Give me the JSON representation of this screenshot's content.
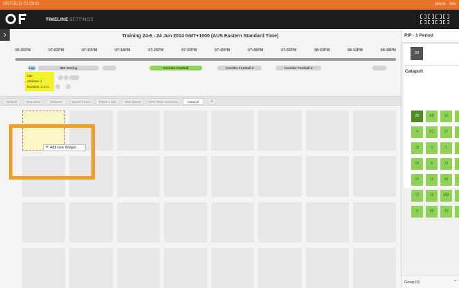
{
  "app": {
    "brand": "ORFIELD CLOUD",
    "user": "peeps · telu"
  },
  "nav": {
    "timeline": "TIMELINE",
    "settings": "SETTINGS"
  },
  "timeline": {
    "title": "Training 24-6 - 24 Jun 2014 GMT+1000 (AUS Eastern Standard Time)",
    "times": [
      "06:55PM",
      "07:02PM",
      "07:10PM",
      "07:18PM",
      "07:25PM",
      "07:33PM",
      "07:40PM",
      "07:48PM",
      "07:55PM",
      "08:03PM",
      "08:11PM",
      "08:18PM"
    ],
    "lanes": [
      {
        "label": "Lap",
        "style": "blue"
      },
      {
        "label": "IMA Testing",
        "style": "gray"
      },
      {
        "label": "",
        "style": "gray"
      },
      {
        "label": "Corridor Football",
        "style": "green"
      },
      {
        "label": "Corridor Football 2",
        "style": "gray"
      },
      {
        "label": "Corridor Football 3",
        "style": "gray"
      },
      {
        "label": "",
        "style": "gray"
      }
    ],
    "tooltip": {
      "line1": "Lap",
      "line2": "Athletes: 1",
      "line3": "Duration: 0.212"
    }
  },
  "tabs": [
    {
      "label": "Default",
      "active": false
    },
    {
      "label": "June 2014",
      "active": false
    },
    {
      "label": "Distance",
      "active": false
    },
    {
      "label": "Speed Zones",
      "active": false
    },
    {
      "label": "Player Load",
      "active": false
    },
    {
      "label": "Max Speed",
      "active": false
    },
    {
      "label": "GPS Team Summary",
      "active": false
    },
    {
      "label": "Catapult",
      "active": true
    }
  ],
  "add_tab": "+",
  "widget": {
    "add_label": "Add new Widget..."
  },
  "sidebar": {
    "pip_title": "PIP - 1 Period",
    "pip_badge": "20",
    "catapult_title": "Catapult",
    "chips": [
      "20",
      "AB",
      "10",
      "",
      "4",
      "DC",
      "27",
      "",
      "18",
      "3",
      "1",
      "",
      "28",
      "8",
      "15",
      "",
      "25",
      "13",
      "48",
      "",
      "12",
      "16",
      "MM",
      "",
      "8",
      "89",
      "16",
      ""
    ],
    "group_label": "Group (0)",
    "group_caret": "⌃"
  },
  "colors": {
    "accent": "#e8742b",
    "highlight": "#f39c22",
    "nav": "#1d1d1d",
    "chip": "#8fd257"
  }
}
